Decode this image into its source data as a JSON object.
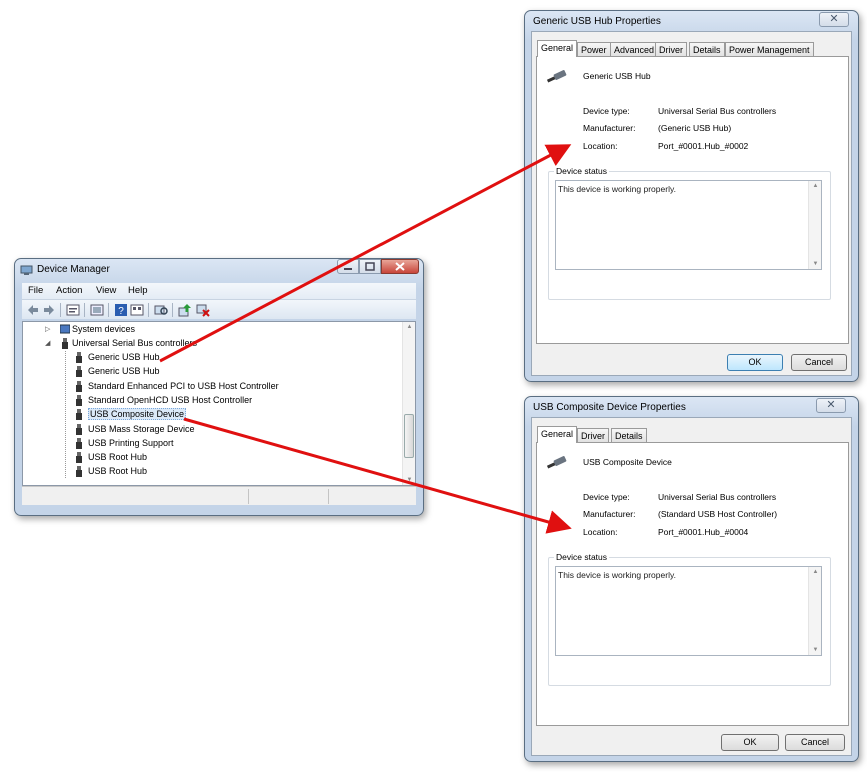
{
  "device_manager": {
    "title": "Device Manager",
    "menu": [
      "File",
      "Action",
      "View",
      "Help"
    ],
    "toolbar_icons": [
      "back-icon",
      "forward-icon",
      "properties-icon",
      "show-hide-icon",
      "help-icon",
      "view-icon",
      "scan-hardware-icon",
      "update-driver-icon",
      "uninstall-icon"
    ],
    "tree": [
      {
        "label": "System devices",
        "level": 1,
        "expander": "▷"
      },
      {
        "label": "Universal Serial Bus controllers",
        "level": 1,
        "expander": "◢"
      },
      {
        "label": "Generic USB Hub",
        "level": 2
      },
      {
        "label": "Generic USB Hub",
        "level": 2
      },
      {
        "label": "Standard Enhanced PCI to USB Host Controller",
        "level": 2
      },
      {
        "label": "Standard OpenHCD USB Host Controller",
        "level": 2
      },
      {
        "label": "USB Composite Device",
        "level": 2,
        "selected": true
      },
      {
        "label": "USB Mass Storage Device",
        "level": 2
      },
      {
        "label": "USB Printing Support",
        "level": 2
      },
      {
        "label": "USB Root Hub",
        "level": 2
      },
      {
        "label": "USB Root Hub",
        "level": 2
      }
    ]
  },
  "hub_dialog": {
    "title": "Generic USB Hub Properties",
    "close_glyph": "✕",
    "tabs": [
      "General",
      "Power",
      "Advanced",
      "Driver",
      "Details",
      "Power Management"
    ],
    "device_name": "Generic USB Hub",
    "labels": {
      "type": "Device type:",
      "manufacturer": "Manufacturer:",
      "location": "Location:"
    },
    "values": {
      "type": "Universal Serial Bus controllers",
      "manufacturer": "(Generic USB Hub)",
      "location": "Port_#0001.Hub_#0002"
    },
    "status_legend": "Device status",
    "status_text": "This device is working properly.",
    "ok": "OK",
    "cancel": "Cancel"
  },
  "composite_dialog": {
    "title": "USB Composite Device Properties",
    "close_glyph": "✕",
    "tabs": [
      "General",
      "Driver",
      "Details"
    ],
    "device_name": "USB Composite Device",
    "labels": {
      "type": "Device type:",
      "manufacturer": "Manufacturer:",
      "location": "Location:"
    },
    "values": {
      "type": "Universal Serial Bus controllers",
      "manufacturer": "(Standard USB Host Controller)",
      "location": "Port_#0001.Hub_#0004"
    },
    "status_legend": "Device status",
    "status_text": "This device is working properly.",
    "ok": "OK",
    "cancel": "Cancel"
  },
  "colors": {
    "arrow": "#e01010",
    "selection": "#dbe9f8",
    "frame": "#c4d4e8"
  }
}
